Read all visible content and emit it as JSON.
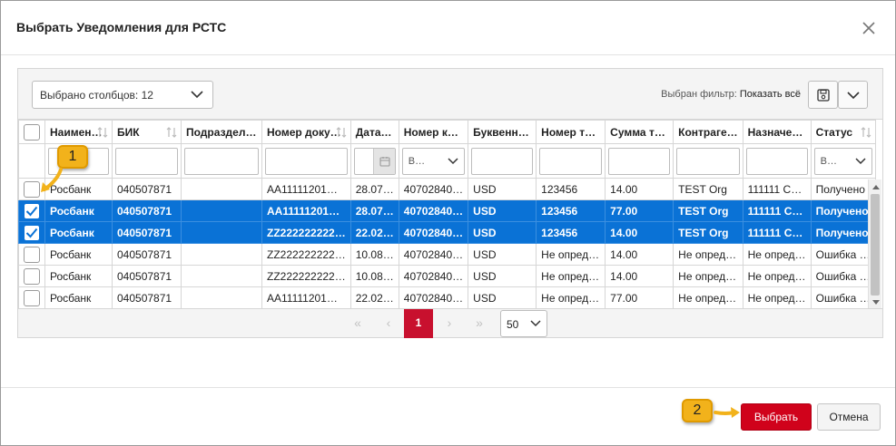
{
  "dialog": {
    "title": "Выбрать Уведомления для РСТС",
    "close_icon": "close-icon"
  },
  "toolbar": {
    "columns_select": "Выбрано столбцов: 12",
    "filter_label": "Выбран фильтр:",
    "filter_value": "Показать всё",
    "save_icon": "save-icon",
    "more_icon": "chevron-down-icon"
  },
  "columns": [
    {
      "label": "Наимен…",
      "filter": "text"
    },
    {
      "label": "БИК",
      "filter": "text"
    },
    {
      "label": "Подраздел…",
      "filter": "text"
    },
    {
      "label": "Номер доку…",
      "filter": "text"
    },
    {
      "label": "Дата…",
      "filter": "date"
    },
    {
      "label": "Номер к…",
      "filter": "select",
      "filter_value": "В…"
    },
    {
      "label": "Буквенн…",
      "filter": "text"
    },
    {
      "label": "Номер т…",
      "filter": "text"
    },
    {
      "label": "Сумма т…",
      "filter": "text"
    },
    {
      "label": "Контраге…",
      "filter": "text"
    },
    {
      "label": "Назначе…",
      "filter": "text"
    },
    {
      "label": "Статус",
      "filter": "select",
      "filter_value": "В…"
    }
  ],
  "rows": [
    {
      "checked": false,
      "selected": false,
      "cells": [
        "Росбанк",
        "040507871",
        "",
        "АА11111201…",
        "28.07…",
        "40702840…",
        "USD",
        "123456",
        "14.00",
        "TEST Org",
        "111111 С…",
        "Получено"
      ]
    },
    {
      "checked": true,
      "selected": true,
      "cells": [
        "Росбанк",
        "040507871",
        "",
        "АА11111201…",
        "28.07…",
        "40702840…",
        "USD",
        "123456",
        "77.00",
        "TEST Org",
        "111111 С…",
        "Получено"
      ]
    },
    {
      "checked": true,
      "selected": true,
      "cells": [
        "Росбанк",
        "040507871",
        "",
        "ZZ222222222…",
        "22.02…",
        "40702840…",
        "USD",
        "123456",
        "14.00",
        "TEST Org",
        "111111 С…",
        "Получено"
      ]
    },
    {
      "checked": false,
      "selected": false,
      "cells": [
        "Росбанк",
        "040507871",
        "",
        "ZZ222222222…",
        "10.08…",
        "40702840…",
        "USD",
        "Не опред…",
        "14.00",
        "Не опред…",
        "Не опред…",
        "Ошибка …"
      ]
    },
    {
      "checked": false,
      "selected": false,
      "cells": [
        "Росбанк",
        "040507871",
        "",
        "ZZ222222222…",
        "10.08…",
        "40702840…",
        "USD",
        "Не опред…",
        "14.00",
        "Не опред…",
        "Не опред…",
        "Ошибка …"
      ]
    },
    {
      "checked": false,
      "selected": false,
      "cells": [
        "Росбанк",
        "040507871",
        "",
        "АА11111201…",
        "22.02…",
        "40702840…",
        "USD",
        "Не опред…",
        "77.00",
        "Не опред…",
        "Не опред…",
        "Ошибка …"
      ]
    }
  ],
  "pager": {
    "first": "«",
    "prev": "‹",
    "current_page": "1",
    "next": "›",
    "last": "»",
    "page_size": "50"
  },
  "footer": {
    "select_label": "Выбрать",
    "cancel_label": "Отмена"
  },
  "callouts": {
    "step1": "1",
    "step2": "2"
  },
  "colors": {
    "accent_red": "#d0021b",
    "selected_row_blue": "#0a72d6",
    "callout_yellow": "#f2b21b"
  }
}
